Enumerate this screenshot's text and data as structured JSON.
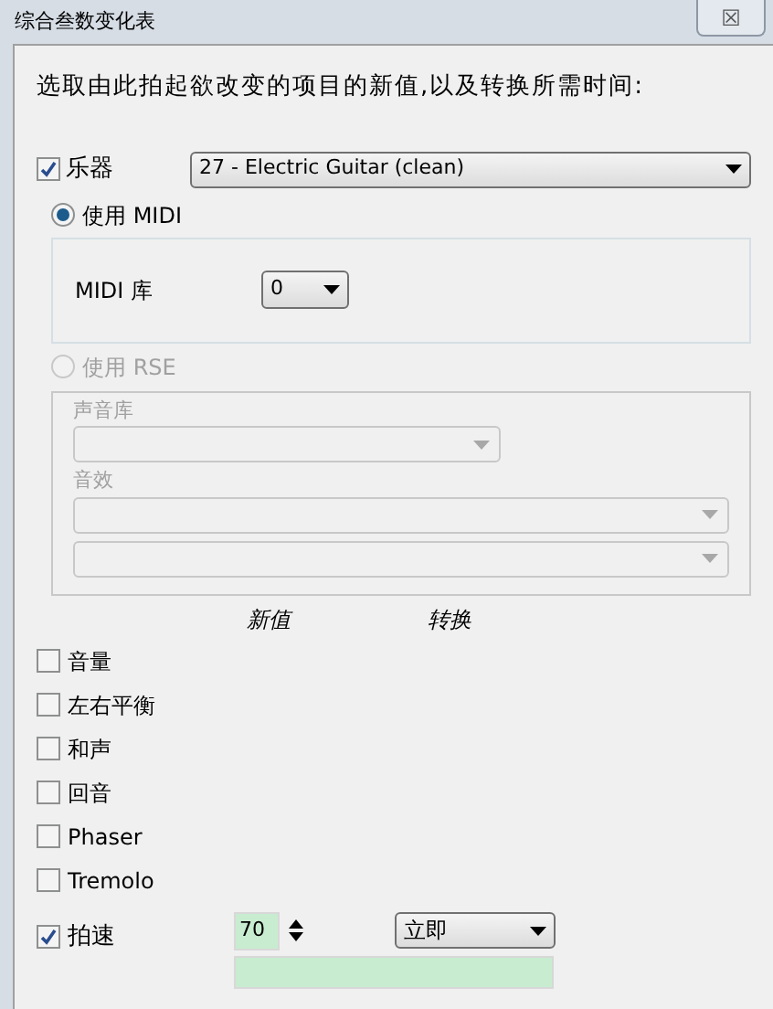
{
  "window": {
    "title": "综合叁数变化表",
    "close_label": "☒"
  },
  "instruction": "选取由此拍起欲改变的项目的新值,以及转换所需时间:",
  "instrument": {
    "label": "乐器",
    "checked": true,
    "value": "27 - Electric Guitar (clean)"
  },
  "midi": {
    "label": "使用 MIDI",
    "selected": true,
    "bank_label": "MIDI 库",
    "bank_value": "0"
  },
  "rse": {
    "label": "使用 RSE",
    "selected": false,
    "disabled": true,
    "soundbank_label": "声音库",
    "effects_label": "音效"
  },
  "columns": [
    "新值",
    "转换"
  ],
  "effects": [
    {
      "label": "音量",
      "checked": false
    },
    {
      "label": "左右平衡",
      "checked": false
    },
    {
      "label": "和声",
      "checked": false
    },
    {
      "label": "回音",
      "checked": false
    },
    {
      "label": "Phaser",
      "checked": false
    },
    {
      "label": "Tremolo",
      "checked": false
    }
  ],
  "tempo": {
    "label": "拍速",
    "checked": true,
    "value": "70",
    "transition": "立即"
  }
}
